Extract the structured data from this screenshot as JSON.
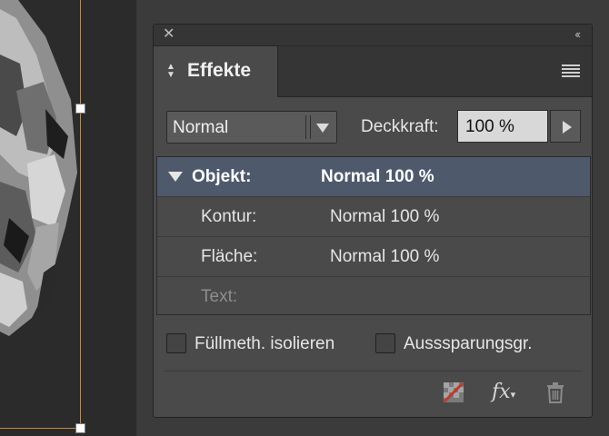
{
  "panel": {
    "title": "Effekte",
    "blend_mode": "Normal",
    "opacity_label": "Deckkraft:",
    "opacity_value": "100 %",
    "targets": [
      {
        "name": "Objekt:",
        "value": "Normal 100 %",
        "selected": true
      },
      {
        "name": "Kontur:",
        "value": "Normal 100 %",
        "selected": false
      },
      {
        "name": "Fläche:",
        "value": "Normal 100 %",
        "selected": false
      },
      {
        "name": "Text:",
        "value": "",
        "selected": false
      }
    ],
    "isolate_blending_label": "Füllmeth. isolieren",
    "knockout_group_label": "Ausssparungsgr.",
    "fx_label": "fx"
  },
  "icons": {
    "close": "close-icon",
    "collapse": "double-chevron-left-icon",
    "panel_menu": "hamburger-menu-icon",
    "clear_effects": "clear-effects-icon",
    "fx": "fx-icon",
    "delete": "trash-icon"
  },
  "colors": {
    "selection": "#4e5a6c",
    "guide": "#c9893a"
  }
}
